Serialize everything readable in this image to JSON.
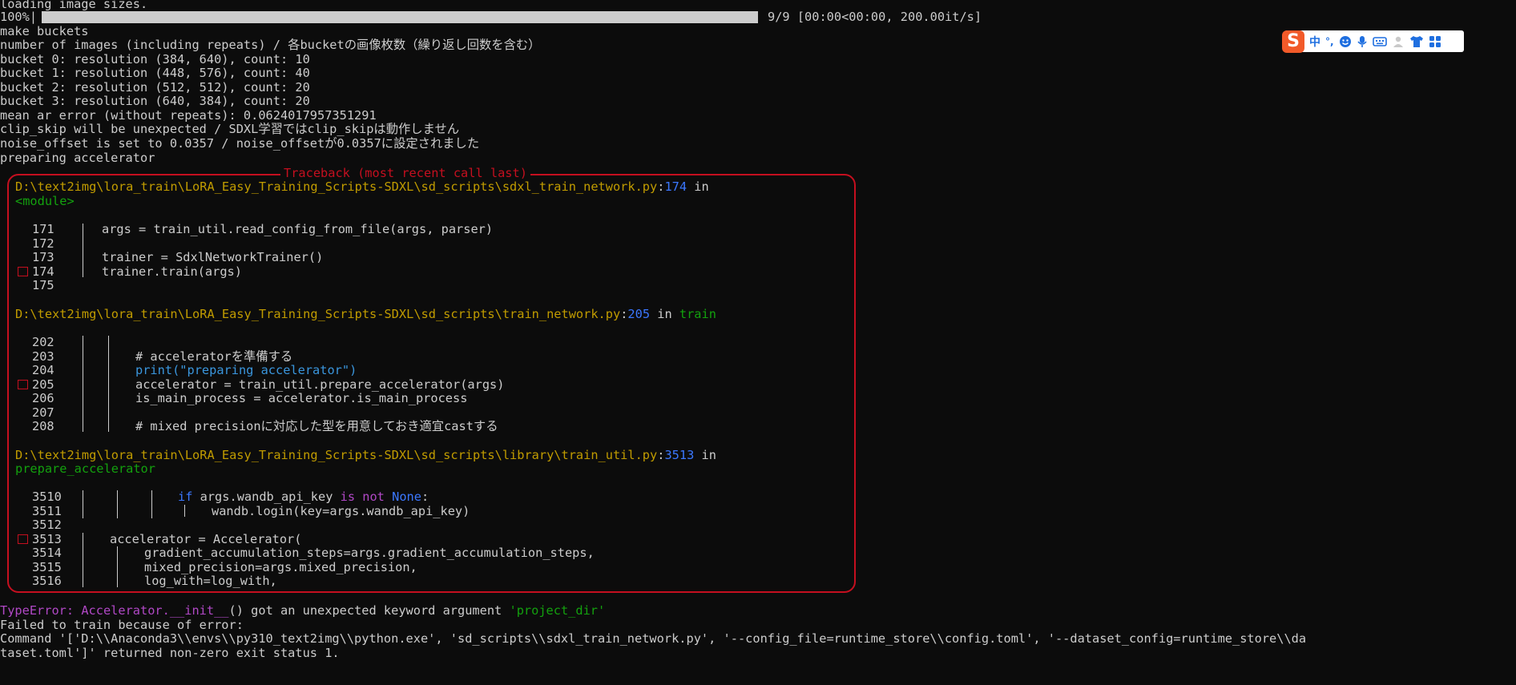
{
  "terminal": {
    "lines": [
      "loading image sizes.",
      "100%|",
      "make buckets",
      "number of images (including repeats) / 各bucketの画像枚数（繰り返し回数を含む）",
      "bucket 0: resolution (384, 640), count: 10",
      "bucket 1: resolution (448, 576), count: 40",
      "bucket 2: resolution (512, 512), count: 20",
      "bucket 3: resolution (640, 384), count: 20",
      "mean ar error (without repeats): 0.0624017957351291",
      "clip_skip will be unexpected / SDXL学習ではclip_skipは動作しません",
      "noise_offset is set to 0.0357 / noise_offsetが0.0357に設定されました",
      "preparing accelerator"
    ],
    "progress": {
      "label": "9/9 [00:00<00:00, 200.00it/s]",
      "percent": 100
    },
    "traceback": {
      "title": "Traceback (most recent call last)",
      "frames": [
        {
          "path": "D:\\text2img\\lora_train\\LoRA_Easy_Training_Scripts-SDXL\\sd_scripts\\sdxl_train_network.py",
          "line": "174",
          "in": " in",
          "func": "<module>",
          "code": [
            {
              "no": "171",
              "text": "args = train_util.read_config_from_file(args, parser)"
            },
            {
              "no": "172",
              "text": ""
            },
            {
              "no": "173",
              "text": "trainer = SdxlNetworkTrainer()"
            },
            {
              "no": "174",
              "text": "trainer.train(args)"
            },
            {
              "no": "175",
              "text": ""
            }
          ]
        },
        {
          "path": "D:\\text2img\\lora_train\\LoRA_Easy_Training_Scripts-SDXL\\sd_scripts\\train_network.py",
          "line": "205",
          "in": " in ",
          "func": "train",
          "code": [
            {
              "no": "202",
              "text": ""
            },
            {
              "no": "203",
              "text": "# acceleratorを準備する"
            },
            {
              "no": "204a",
              "text": "print"
            },
            {
              "no": "204b",
              "text": "(\"preparing accelerator\")"
            },
            {
              "no": "205",
              "text": "accelerator = train_util.prepare_accelerator(args)"
            },
            {
              "no": "206",
              "text": "is_main_process = accelerator.is_main_process"
            },
            {
              "no": "207",
              "text": ""
            },
            {
              "no": "208",
              "text": "# mixed precisionに対応した型を用意しておき適宜castする"
            }
          ],
          "numbers": [
            "202",
            "203",
            "204",
            "205",
            "206",
            "207",
            "208"
          ]
        },
        {
          "path": "D:\\text2img\\lora_train\\LoRA_Easy_Training_Scripts-SDXL\\sd_scripts\\library\\train_util.py",
          "line": "3513",
          "in": " in",
          "func": "prepare_accelerator",
          "numbers": [
            "3510",
            "3511",
            "3512",
            "3513",
            "3514",
            "3515",
            "3516"
          ],
          "kw_if": "if",
          "cond_a": "args.wandb_api_key ",
          "kw_isnot": "is not",
          "kw_none": "None",
          "colon": ":",
          "l3511": "wandb.login(key=args.wandb_api_key)",
          "l3513": "accelerator = Accelerator(",
          "l3514": "gradient_accumulation_steps=args.gradient_accumulation_steps,",
          "l3515": "mixed_precision=args.mixed_precision,",
          "l3516": "log_with=log_with,"
        }
      ]
    },
    "error": {
      "type": "TypeError: ",
      "message_a": "Accelerator.__init__",
      "message_b": "() got an unexpected keyword argument ",
      "message_c": "'project_dir'"
    },
    "footer": [
      "Failed to train because of error:",
      "Command '['D:\\\\Anaconda3\\\\envs\\\\py310_text2img\\\\python.exe', 'sd_scripts\\\\sdxl_train_network.py', '--config_file=runtime_store\\\\config.toml', '--dataset_config=runtime_store\\\\da",
      "taset.toml']' returned non-zero exit status 1."
    ]
  },
  "ime_toolbar": {
    "logo": "S",
    "mode": "中",
    "items": [
      "punctuation-icon",
      "emoji-icon",
      "microphone-icon",
      "keyboard-icon",
      "user-icon",
      "skin-icon",
      "grid-icon"
    ],
    "accent": "#f25a29",
    "punct": "°,"
  }
}
